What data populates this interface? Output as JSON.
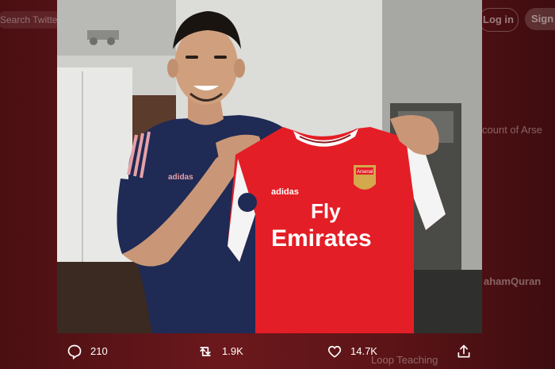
{
  "background": {
    "search_text": "Search Twitter",
    "login_label": "Log in",
    "signup_label": "Sign up",
    "account_text": "count of Arse",
    "handle_text": "ahamQuran",
    "footer_text": "Loop  Teaching"
  },
  "photo": {
    "shirt_sponsor_line1": "Fly",
    "shirt_sponsor_line2": "Emirates",
    "shirt_brand": "adidas",
    "shirt_crest_text": "Arsenal",
    "tee_brand": "adidas"
  },
  "actions": {
    "replies": "210",
    "retweets": "1.9K",
    "likes": "14.7K"
  },
  "colors": {
    "overlay": "#5a1316",
    "shirt_red": "#e41e26",
    "navy": "#1f2a55"
  }
}
